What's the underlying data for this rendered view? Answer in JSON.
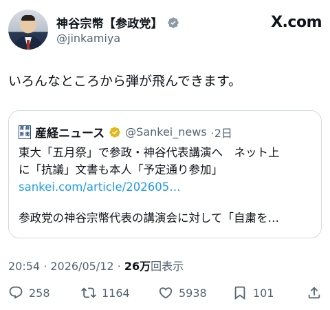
{
  "author": {
    "display_name": "神谷宗幣【参政党】",
    "handle": "@jinkamiya"
  },
  "watermark": "X.com",
  "tweet": {
    "text": "いろんなところから弾が飛んできます。"
  },
  "quote": {
    "logo_chars": [
      "産",
      "経",
      "新",
      "聞"
    ],
    "name": "産経ニュース",
    "handle": "@Sankei_news",
    "time": "·2日",
    "body_line1": "東大「五月祭」で参政・神谷代表講演へ　ネット上",
    "body_line2": "に「抗議」文書も本人「予定通り参加」",
    "link": "sankei.com/article/202605…",
    "summary": "参政党の神谷宗幣代表の講演会に対して「自粛を…"
  },
  "meta": {
    "time": "20:54 · 2026/05/12 · ",
    "views_count": "26万",
    "views_label": "回表示"
  },
  "actions": {
    "replies": "258",
    "retweets": "1164",
    "likes": "5938",
    "bookmarks": "101"
  },
  "colors": {
    "verified_gold": "#e2b719",
    "link_blue": "#1d9bf0",
    "muted_text": "#536471",
    "border": "#cfd9de"
  }
}
